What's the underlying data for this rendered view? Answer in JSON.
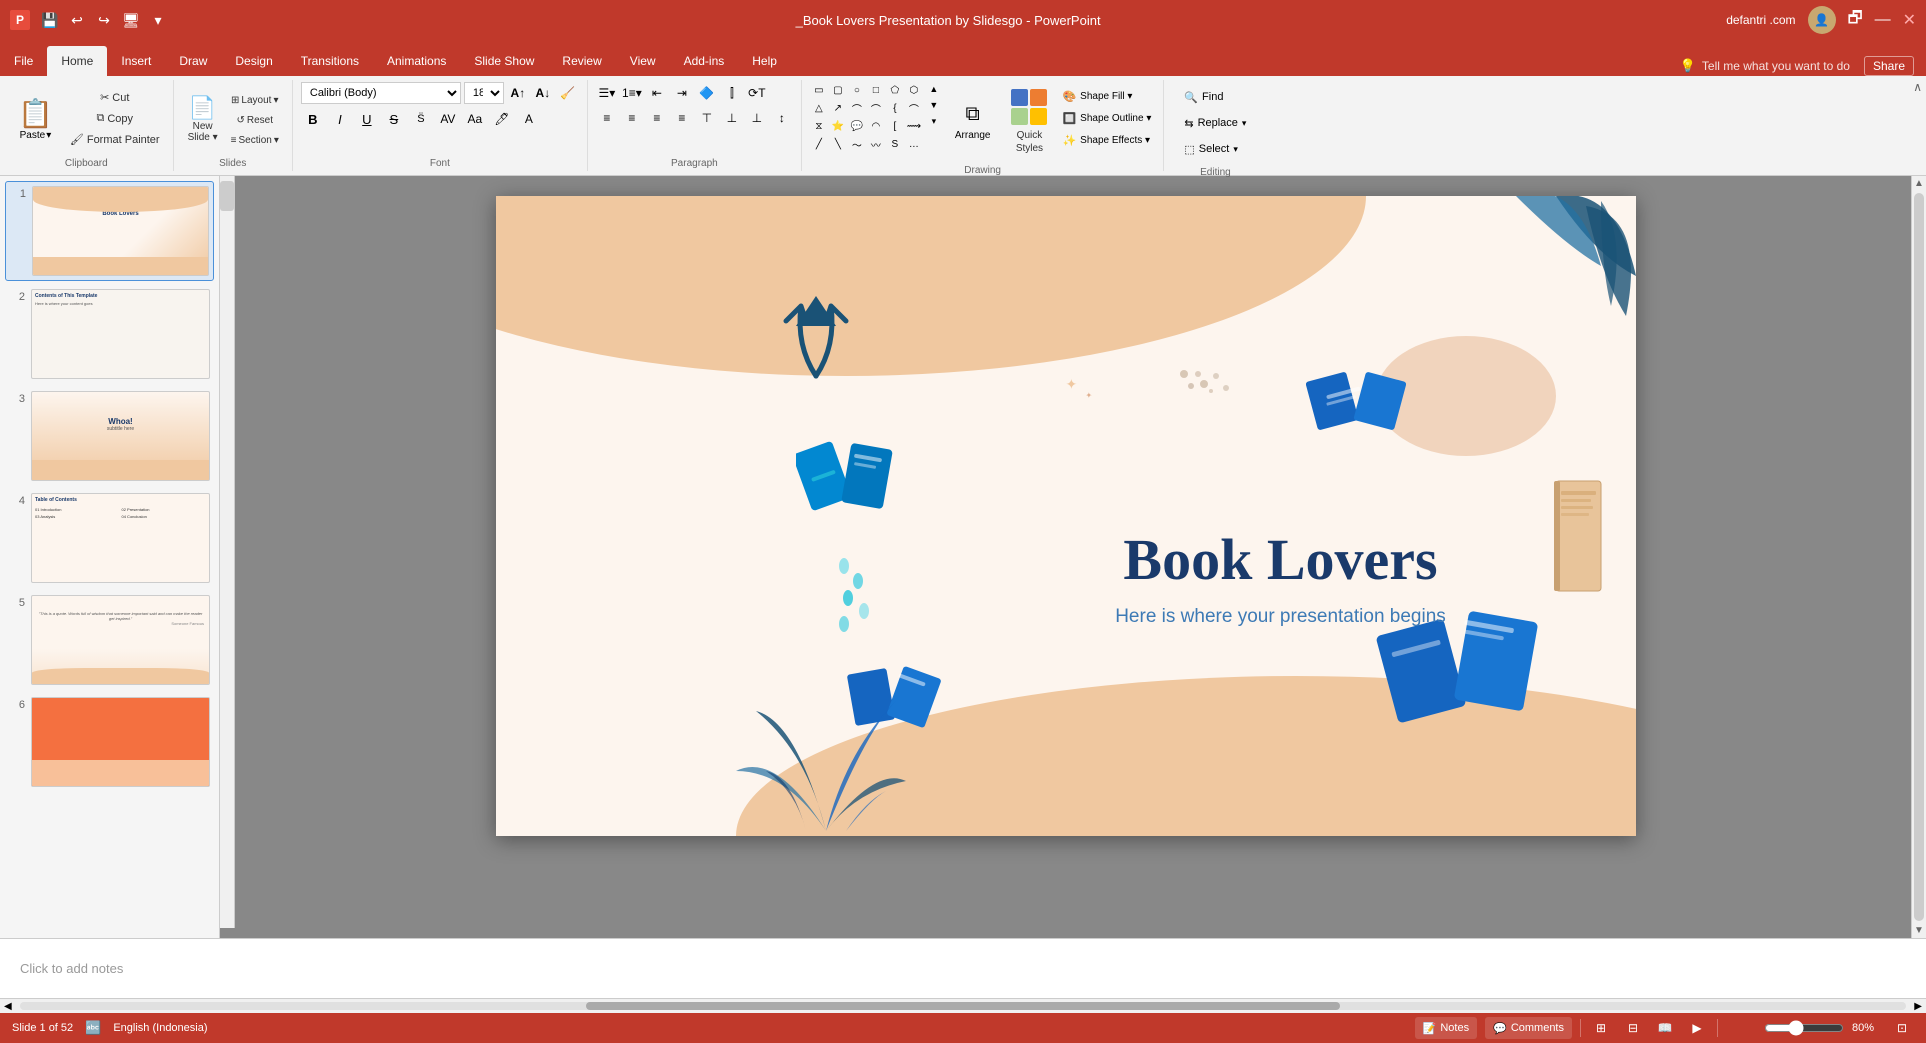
{
  "window": {
    "title": "_Book Lovers Presentation by Slidesgo - PowerPoint",
    "user": "defantri .com",
    "controls": [
      "minimize",
      "restore",
      "close"
    ]
  },
  "qat": {
    "buttons": [
      "save",
      "undo",
      "redo",
      "customize",
      "more"
    ]
  },
  "tabs": {
    "items": [
      "File",
      "Home",
      "Insert",
      "Draw",
      "Design",
      "Transitions",
      "Animations",
      "Slide Show",
      "Review",
      "View",
      "Add-ins",
      "Help"
    ],
    "active": "Home"
  },
  "ribbon": {
    "groups": {
      "clipboard": {
        "label": "Clipboard",
        "paste_label": "Paste",
        "cut_label": "Cut",
        "copy_label": "Copy",
        "painter_label": "Format Painter"
      },
      "slides": {
        "label": "Slides",
        "new_slide_label": "New\nSlide",
        "layout_label": "Layout",
        "reset_label": "Reset",
        "section_label": "Section"
      },
      "font": {
        "label": "Font",
        "font_name": "Calibri (Body)",
        "font_size": "18",
        "bold": "B",
        "italic": "I",
        "underline": "U",
        "strikethrough": "S"
      },
      "paragraph": {
        "label": "Paragraph"
      },
      "drawing": {
        "label": "Drawing",
        "arrange_label": "Arrange",
        "quick_styles_label": "Quick\nStyles"
      },
      "editing": {
        "label": "Editing",
        "find_label": "Find",
        "replace_label": "Replace",
        "select_label": "Select"
      }
    }
  },
  "tell_me": {
    "placeholder": "Tell me what you want to do",
    "icon": "🔍"
  },
  "slide_panel": {
    "slides": [
      {
        "num": 1,
        "type": "title",
        "active": true
      },
      {
        "num": 2,
        "type": "contents"
      },
      {
        "num": 3,
        "type": "whoa"
      },
      {
        "num": 4,
        "type": "table"
      },
      {
        "num": 5,
        "type": "quote"
      },
      {
        "num": 6,
        "type": "color"
      }
    ]
  },
  "slide": {
    "title": "Book Lovers",
    "subtitle": "Here is where your presentation begins"
  },
  "notes": {
    "placeholder": "Click to add notes",
    "label": "Notes"
  },
  "statusbar": {
    "slide_info": "Slide 1 of 52",
    "language": "English (Indonesia)",
    "notes_label": "Notes",
    "comments_label": "Comments",
    "zoom_level": "80%",
    "share_label": "Share"
  },
  "shapes": {
    "fill_label": "Shape Fill ▾",
    "outline_label": "Shape Outline ▾",
    "effects_label": "Shape Effects ▾"
  }
}
